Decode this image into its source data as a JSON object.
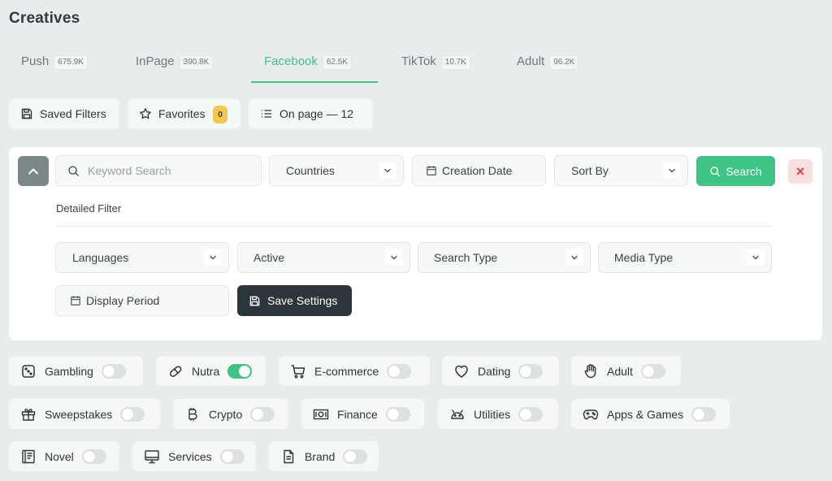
{
  "page": {
    "title": "Creatives"
  },
  "tabs": [
    {
      "label": "Push",
      "count": "675.9K"
    },
    {
      "label": "InPage",
      "count": "390.8K"
    },
    {
      "label": "Facebook",
      "count": "62.5K",
      "active": true
    },
    {
      "label": "TikTok",
      "count": "10.7K"
    },
    {
      "label": "Adult",
      "count": "96.2K"
    }
  ],
  "toolbar": {
    "saved_filters": "Saved Filters",
    "favorites": "Favorites",
    "favorites_count": "0",
    "on_page": "On page — 12"
  },
  "filters": {
    "keyword_placeholder": "Keyword Search",
    "countries": "Countries",
    "creation_date": "Creation Date",
    "sort_by": "Sort By",
    "search_button": "Search",
    "close_button": "×",
    "detailed_filter": "Detailed Filter",
    "languages": "Languages",
    "active": "Active",
    "search_type": "Search Type",
    "media_type": "Media Type",
    "display_period": "Display Period",
    "save_settings": "Save Settings"
  },
  "categories": [
    {
      "label": "Gambling",
      "icon": "dice-icon",
      "enabled": false
    },
    {
      "label": "Nutra",
      "icon": "pill-icon",
      "enabled": true
    },
    {
      "label": "E-commerce",
      "icon": "cart-icon",
      "enabled": false
    },
    {
      "label": "Dating",
      "icon": "heart-icon",
      "enabled": false
    },
    {
      "label": "Adult",
      "icon": "hand-icon",
      "enabled": false
    },
    {
      "label": "Sweepstakes",
      "icon": "gift-icon",
      "enabled": false
    },
    {
      "label": "Crypto",
      "icon": "bitcoin-icon",
      "enabled": false
    },
    {
      "label": "Finance",
      "icon": "money-icon",
      "enabled": false
    },
    {
      "label": "Utilities",
      "icon": "android-icon",
      "enabled": false
    },
    {
      "label": "Apps & Games",
      "icon": "gamepad-icon",
      "enabled": false
    },
    {
      "label": "Novel",
      "icon": "book-icon",
      "enabled": false
    },
    {
      "label": "Services",
      "icon": "monitor-icon",
      "enabled": false
    },
    {
      "label": "Brand",
      "icon": "document-icon",
      "enabled": false
    }
  ],
  "colors": {
    "accent": "#3ec485",
    "background": "#e9eced",
    "dark_button": "#2c3539",
    "badge": "#f3c84e",
    "close": "#e0404a"
  }
}
